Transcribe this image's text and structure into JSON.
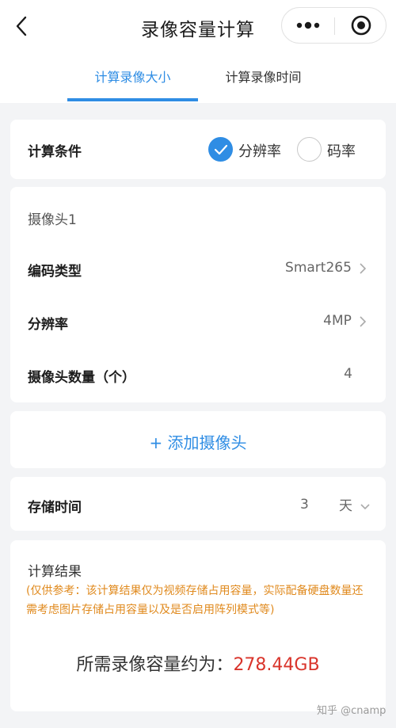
{
  "nav": {
    "title": "录像容量计算"
  },
  "tabs": [
    {
      "label": "计算录像大小",
      "active": true
    },
    {
      "label": "计算录像时间",
      "active": false
    }
  ],
  "condition": {
    "label": "计算条件",
    "options": [
      {
        "label": "分辨率",
        "checked": true
      },
      {
        "label": "码率",
        "checked": false
      }
    ]
  },
  "camera": {
    "header": "摄像头1",
    "rows": [
      {
        "label": "编码类型",
        "value": "Smart265"
      },
      {
        "label": "分辨率",
        "value": "4MP"
      },
      {
        "label": "摄像头数量（个）",
        "value": "4"
      }
    ]
  },
  "add_camera": {
    "label": "+ 添加摄像头"
  },
  "storage": {
    "label": "存储时间",
    "value": "3",
    "unit": "天"
  },
  "result": {
    "header": "计算结果",
    "hint": "(仅供参考：该计算结果仅为视频存储占用容量，实际配备硬盘数量还需考虑图片存储占用容量以及是否启用阵列模式等)",
    "prefix": "所需录像容量约为：",
    "value": "278.44GB"
  },
  "watermark": "知乎 @cnamp",
  "colors": {
    "accent": "#2f8de4",
    "result_value": "#d9342b",
    "hint": "#e08a1e",
    "background": "#f3f4f6"
  }
}
